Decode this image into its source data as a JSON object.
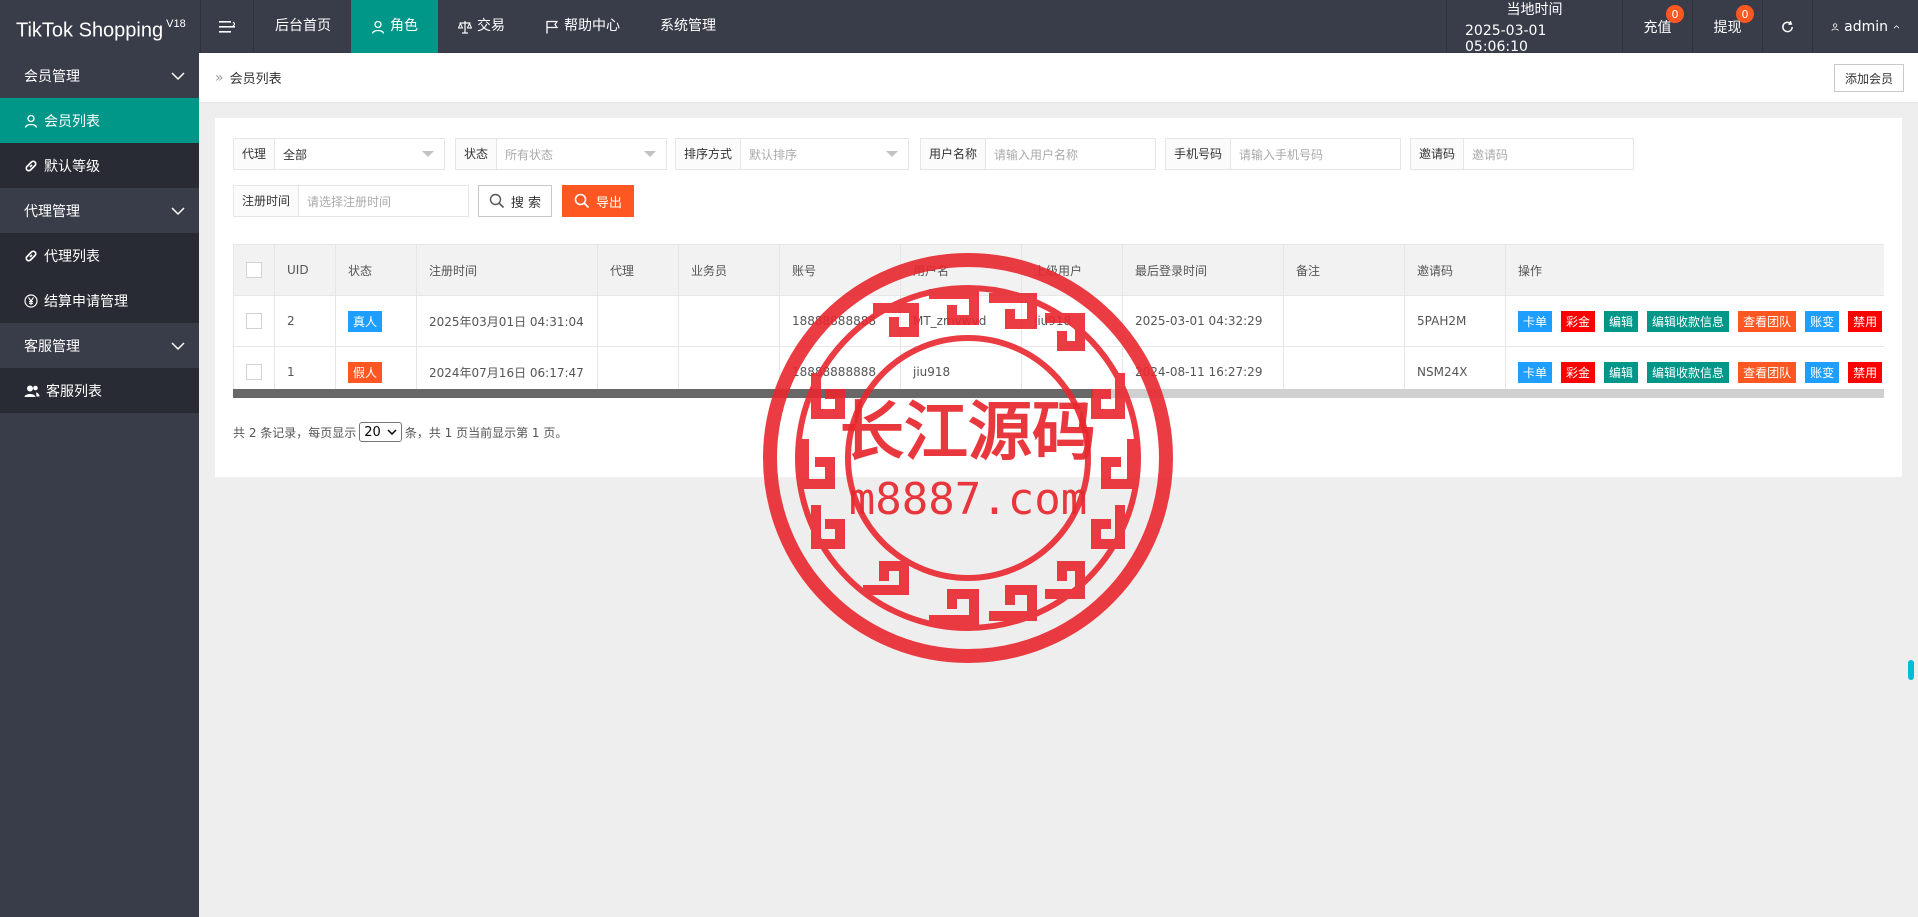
{
  "app": {
    "title": "TikTok Shopping",
    "version": "V18"
  },
  "header": {
    "nav": [
      {
        "label": "后台首页",
        "active": false
      },
      {
        "label": "角色",
        "active": true
      },
      {
        "label": "交易",
        "active": false
      },
      {
        "label": "帮助中心",
        "active": false
      },
      {
        "label": "系统管理",
        "active": false
      }
    ],
    "time_label": "当地时间",
    "time_value": "2025-03-01 05:06:10",
    "recharge_label": "充值",
    "recharge_badge": "0",
    "withdraw_label": "提现",
    "withdraw_badge": "0",
    "user": "admin"
  },
  "sidebar": {
    "groups": [
      {
        "label": "会员管理",
        "items": [
          {
            "label": "会员列表",
            "icon": "user-icon",
            "active": true
          },
          {
            "label": "默认等级",
            "icon": "link-icon",
            "active": false
          }
        ]
      },
      {
        "label": "代理管理",
        "items": [
          {
            "label": "代理列表",
            "icon": "link-icon",
            "active": false
          },
          {
            "label": "结算申请管理",
            "icon": "yen-icon",
            "active": false
          }
        ]
      },
      {
        "label": "客服管理",
        "items": [
          {
            "label": "客服列表",
            "icon": "users-icon",
            "active": false
          }
        ]
      }
    ]
  },
  "breadcrumb": {
    "current": "会员列表"
  },
  "actions": {
    "add_member": "添加会员"
  },
  "filters": {
    "agent": {
      "label": "代理",
      "value": "全部"
    },
    "status": {
      "label": "状态",
      "placeholder": "所有状态"
    },
    "sort": {
      "label": "排序方式",
      "placeholder": "默认排序"
    },
    "username": {
      "label": "用户名称",
      "placeholder": "请输入用户名称"
    },
    "phone": {
      "label": "手机号码",
      "placeholder": "请输入手机号码"
    },
    "invite": {
      "label": "邀请码",
      "placeholder": "邀请码"
    },
    "regtime": {
      "label": "注册时间",
      "placeholder": "请选择注册时间"
    },
    "search_btn": "搜 索",
    "export_btn": "导出"
  },
  "table": {
    "columns": [
      "UID",
      "状态",
      "注册时间",
      "代理",
      "业务员",
      "账号",
      "用户名",
      "上级用户",
      "最后登录时间",
      "备注",
      "邀请码",
      "操作"
    ],
    "rows": [
      {
        "uid": "2",
        "status": "真人",
        "reg_time": "2025年03月01日 04:31:04",
        "agent": "",
        "salesman": "",
        "account": "18888888888",
        "username": "MT_zmvwvd",
        "parent": "jiu918",
        "last_login": "2025-03-01 04:32:29",
        "remark": "",
        "invite": "5PAH2M"
      },
      {
        "uid": "1",
        "status": "假人",
        "reg_time": "2024年07月16日 06:17:47",
        "agent": "",
        "salesman": "",
        "account": "18888888888",
        "username": "jiu918",
        "parent": "",
        "last_login": "2024-08-11 16:27:29",
        "remark": "",
        "invite": "NSM24X"
      }
    ],
    "ops": [
      "卡单",
      "彩金",
      "编辑",
      "编辑收款信息",
      "查看团队",
      "账变",
      "禁用"
    ]
  },
  "pager": {
    "prefix": "共 2 条记录，每页显示",
    "page_size": "20",
    "suffix": "条，共 1 页当前显示第 1 页。"
  },
  "watermark": {
    "title": "长江源码",
    "url": "m8887.com"
  },
  "colors": {
    "header_bg": "#393d49",
    "accent": "#009688",
    "orange": "#ff5722",
    "blue": "#1e9fff",
    "red": "#ff0000",
    "stamp": "#e8272e"
  }
}
